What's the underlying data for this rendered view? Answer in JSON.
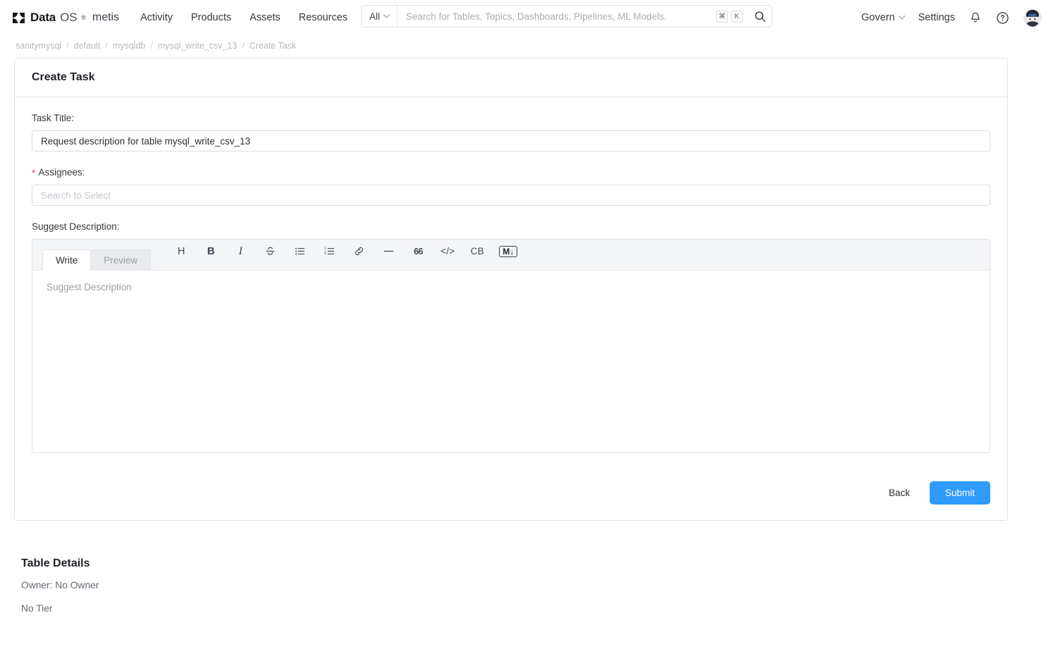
{
  "header": {
    "brand": {
      "data": "Data",
      "os": "OS",
      "reg": "®",
      "suite": "metis",
      "mark_icon": "dataos-logo-icon"
    },
    "nav": [
      {
        "label": "Activity"
      },
      {
        "label": "Products"
      },
      {
        "label": "Assets"
      },
      {
        "label": "Resources"
      }
    ],
    "search": {
      "scope": "All",
      "placeholder": "Search for Tables, Topics, Dashboards, Pipelines, ML Models.",
      "value": "",
      "shortcut_keys": [
        "⌘",
        "K"
      ],
      "search_icon": "search-icon",
      "chevron_icon": "chevron-down-icon"
    },
    "govern": "Govern",
    "settings": "Settings",
    "bell_icon": "notification-bell-icon",
    "help_icon": "help-circle-icon",
    "avatar_icon": "user-avatar"
  },
  "breadcrumb": {
    "items": [
      {
        "label": "sanitymysql"
      },
      {
        "label": "default"
      },
      {
        "label": "mysqldb"
      },
      {
        "label": "mysql_write_csv_13"
      },
      {
        "label": "Create Task"
      }
    ],
    "separator": "/"
  },
  "card": {
    "title": "Create Task",
    "task_title": {
      "label": "Task Title:",
      "value": "Request description for table mysql_write_csv_13",
      "placeholder": ""
    },
    "assignees": {
      "label": "Assignees:",
      "required_marker": "*",
      "value": "",
      "placeholder": "Search to Select"
    },
    "suggest_description": {
      "label": "Suggest Description:",
      "tabs": [
        {
          "label": "Write",
          "active": true
        },
        {
          "label": "Preview",
          "active": false
        }
      ],
      "toolbar": [
        {
          "name": "heading-icon",
          "glyph": "H"
        },
        {
          "name": "bold-icon",
          "glyph": "B"
        },
        {
          "name": "italic-icon",
          "glyph": "I"
        },
        {
          "name": "strikethrough-icon",
          "glyph": "S"
        },
        {
          "name": "bullet-list-icon",
          "glyph": ""
        },
        {
          "name": "numbered-list-icon",
          "glyph": ""
        },
        {
          "name": "link-icon",
          "glyph": ""
        },
        {
          "name": "horizontal-rule-icon",
          "glyph": "—"
        },
        {
          "name": "blockquote-icon",
          "glyph": "66"
        },
        {
          "name": "inline-code-icon",
          "glyph": "</>"
        },
        {
          "name": "code-block-icon",
          "glyph": "CB"
        },
        {
          "name": "markdown-icon",
          "glyph": "M↓"
        }
      ],
      "editor_placeholder": "Suggest Description",
      "editor_value": ""
    },
    "back_label": "Back",
    "submit_label": "Submit"
  },
  "table_details": {
    "title": "Table Details",
    "owner": "Owner: No Owner",
    "tier": "No Tier"
  },
  "colors": {
    "accent": "#2f9bff",
    "required": "#e8415a",
    "border": "#dfe3e8",
    "muted_text": "#9aa0a8"
  }
}
